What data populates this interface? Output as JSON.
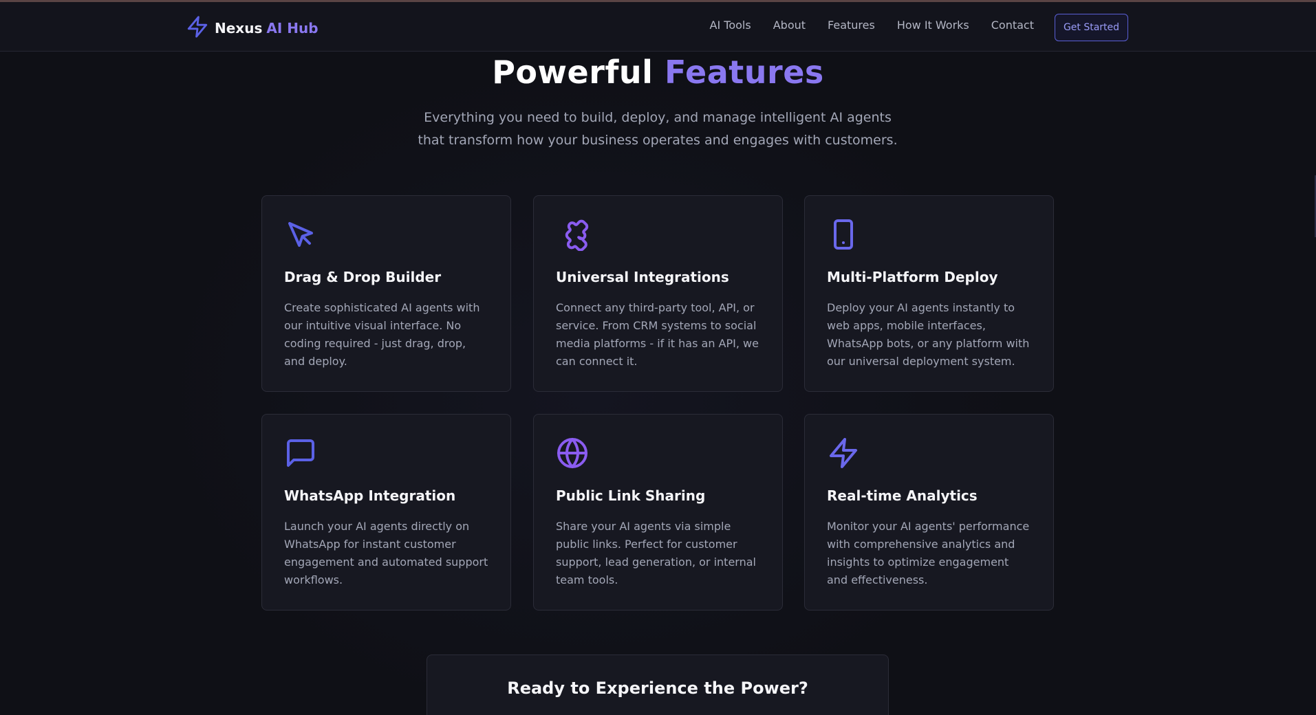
{
  "brand": {
    "name": "Nexus",
    "accent": "AI Hub",
    "icon": "lightning-icon"
  },
  "nav": {
    "links": [
      "AI Tools",
      "About",
      "Features",
      "How It Works",
      "Contact"
    ],
    "cta": "Get Started"
  },
  "hero": {
    "title_main": "Powerful",
    "title_accent": "Features",
    "subtitle": "Everything you need to build, deploy, and manage intelligent AI agents that transform how your business operates and engages with customers."
  },
  "features": [
    {
      "icon": "cursor-pointer-icon",
      "title": "Drag & Drop Builder",
      "description": "Create sophisticated AI agents with our intuitive visual interface. No coding required - just drag, drop, and deploy."
    },
    {
      "icon": "puzzle-icon",
      "title": "Universal Integrations",
      "description": "Connect any third-party tool, API, or service. From CRM systems to social media platforms - if it has an API, we can connect it."
    },
    {
      "icon": "smartphone-icon",
      "title": "Multi-Platform Deploy",
      "description": "Deploy your AI agents instantly to web apps, mobile interfaces, WhatsApp bots, or any platform with our universal deployment system."
    },
    {
      "icon": "message-square-icon",
      "title": "WhatsApp Integration",
      "description": "Launch your AI agents directly on WhatsApp for instant customer engagement and automated support workflows."
    },
    {
      "icon": "globe-icon",
      "title": "Public Link Sharing",
      "description": "Share your AI agents via simple public links. Perfect for customer support, lead generation, or internal team tools."
    },
    {
      "icon": "lightning-icon",
      "title": "Real-time Analytics",
      "description": "Monitor your AI agents' performance with comprehensive analytics and insights to optimize engagement and effectiveness."
    }
  ],
  "cta_section": {
    "title": "Ready to Experience the Power?"
  },
  "colors": {
    "accent": "#8a78f0",
    "icon_blue": "#5b61e6",
    "background": "#0f1016",
    "card": "#171821"
  }
}
